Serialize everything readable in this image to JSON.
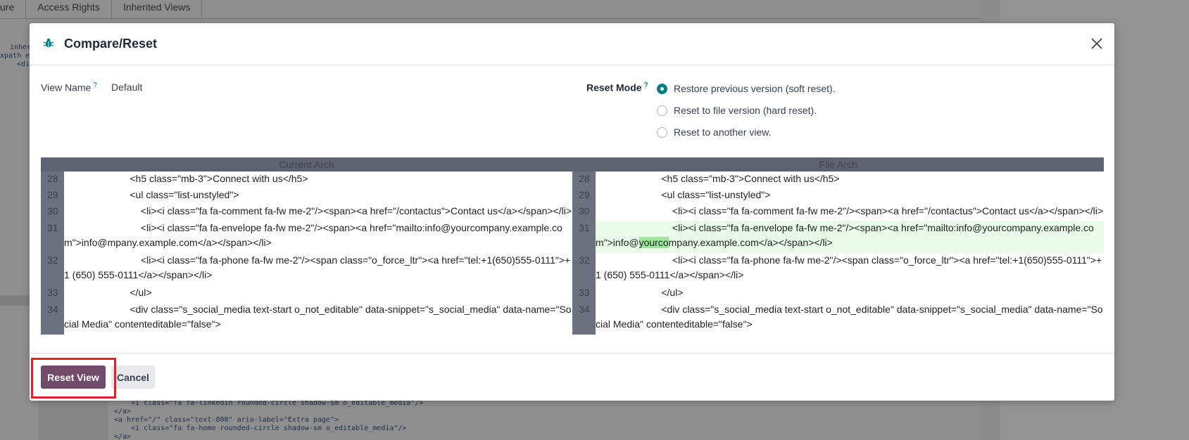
{
  "background": {
    "tabs": [
      "ure",
      "Access Rights",
      "Inherited Views"
    ],
    "code_top": [
      "inheri",
      "xpath e",
      "  <div"
    ],
    "code_bottom": [
      "    <i class=\"fa fa-linkedin rounded-circle shadow-sm o_editable_media\"/>",
      "</a>",
      "<a href=\"/\" class=\"text-800\" aria-label=\"Extra page\">",
      "    <i class=\"fa fa-home rounded-circle shadow-sm o_editable_media\"/>",
      "</a>"
    ]
  },
  "modal": {
    "title": "Compare/Reset",
    "close_symbol": "×",
    "view_name_label": "View Name",
    "view_name_help": "?",
    "view_name_value": "Default",
    "reset_mode_label": "Reset Mode",
    "reset_mode_help": "?",
    "reset_options": [
      {
        "label": "Restore previous version (soft reset).",
        "checked": true
      },
      {
        "label": "Reset to file version (hard reset).",
        "checked": false
      },
      {
        "label": "Reset to another view.",
        "checked": false
      }
    ],
    "diff": {
      "left_header": "Current Arch",
      "right_header": "File Arch",
      "rows": [
        {
          "ln": "28",
          "left": "                        <h5 class=\"mb-3\">Connect with us</h5>",
          "right": "                        <h5 class=\"mb-3\">Connect with us</h5>"
        },
        {
          "ln": "29",
          "left": "                        <ul class=\"list-unstyled\">",
          "right": "                        <ul class=\"list-unstyled\">"
        },
        {
          "ln": "30",
          "left": "                            <li><i class=\"fa fa-comment fa-fw me-2\"/><span><a href=\"/contactus\">Contact us</a></span></li>",
          "right": "                            <li><i class=\"fa fa-comment fa-fw me-2\"/><span><a href=\"/contactus\">Contact us</a></span></li>"
        },
        {
          "ln": "31",
          "left": "                            <li><i class=\"fa fa-envelope fa-fw me-2\"/><span><a href=\"mailto:info@yourcompany.example.com\">info@mpany.example.com</a></span></li>",
          "right_pre": "                            <li><i class=\"fa fa-envelope fa-fw me-2\"/><span><a href=\"mailto:info@yourcompany.example.com\">info@",
          "right_hl": "yourco",
          "right_post": "mpany.example.com</a></span></li>"
        },
        {
          "ln": "32",
          "left": "                            <li><i class=\"fa fa-phone fa-fw me-2\"/><span class=\"o_force_ltr\"><a href=\"tel:+1(650)555-0111\">+1 (650) 555-0111</a></span></li>",
          "right": "                            <li><i class=\"fa fa-phone fa-fw me-2\"/><span class=\"o_force_ltr\"><a href=\"tel:+1(650)555-0111\">+1 (650) 555-0111</a></span></li>"
        },
        {
          "ln": "33",
          "left": "                        </ul>",
          "right": "                        </ul>"
        },
        {
          "ln": "34",
          "left": "                        <div class=\"s_social_media text-start o_not_editable\" data-snippet=\"s_social_media\" data-name=\"Social Media\" contenteditable=\"false\">",
          "right": "                        <div class=\"s_social_media text-start o_not_editable\" data-snippet=\"s_social_media\" data-name=\"Social Media\" contenteditable=\"false\">"
        }
      ]
    },
    "reset_button": "Reset View",
    "cancel_button": "Cancel"
  },
  "colors": {
    "primary": "#714b67",
    "accent": "#017e84",
    "highlight_box": "#e0202a",
    "diff_added_bg": "#e9fbe9",
    "diff_changed_bg": "#9ce79c"
  }
}
